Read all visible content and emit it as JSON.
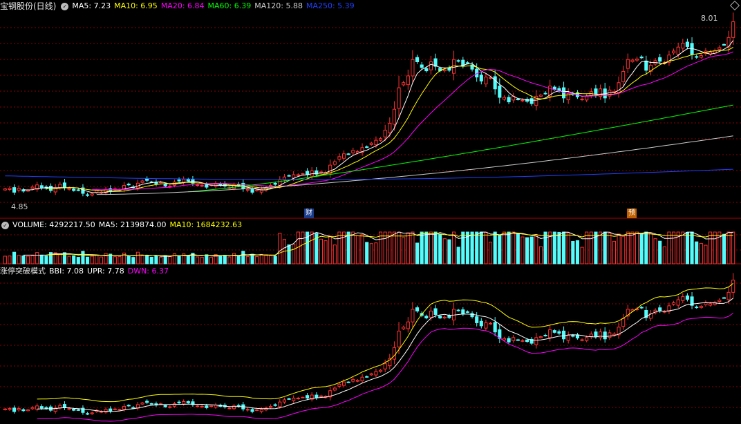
{
  "stock": {
    "name": "宝钢股份(日线)"
  },
  "main_indicators": [
    {
      "label": "MA5: 7.23",
      "color": "#ffffff"
    },
    {
      "label": "MA10: 6.95",
      "color": "#ffff00"
    },
    {
      "label": "MA20: 6.84",
      "color": "#ff00ff"
    },
    {
      "label": "MA60: 6.39",
      "color": "#00ff00"
    },
    {
      "label": "MA120: 5.88",
      "color": "#cccccc"
    },
    {
      "label": "MA250: 5.39",
      "color": "#2040ff"
    }
  ],
  "price_labels": {
    "high": "8.01",
    "low": "4.85"
  },
  "markers": {
    "cai": "财",
    "yu": "预"
  },
  "volume_panel": {
    "indicators": [
      {
        "label": "VOLUME: 4292217.50",
        "color": "#ffffff"
      },
      {
        "label": "MA5: 2139874.00",
        "color": "#ffffff"
      },
      {
        "label": "MA10: 1684232.63",
        "color": "#ffff00"
      }
    ]
  },
  "bbi_panel": {
    "name": "涨停突破模式",
    "indicators": [
      {
        "label": "BBI: 7.08",
        "color": "#ffffff"
      },
      {
        "label": "UPR: 7.78",
        "color": "#ffffff"
      },
      {
        "label": "DWN: 6.37",
        "color": "#ff00ff"
      }
    ]
  },
  "colors": {
    "up": "#ff3232",
    "down": "#54fcfc",
    "grid": "#8b0000",
    "divider": "#b00000"
  },
  "chart_data": {
    "type": "candlestick",
    "closes": [
      5.05,
      5.06,
      4.99,
      5.06,
      5.01,
      5.03,
      5.08,
      5.12,
      5.07,
      5.06,
      5.02,
      5.07,
      5.13,
      5.08,
      5.06,
      5.02,
      5.03,
      4.97,
      4.94,
      4.96,
      5.02,
      4.99,
      5.04,
      5.0,
      5.05,
      5.04,
      5.11,
      5.12,
      5.08,
      5.15,
      5.19,
      5.2,
      5.17,
      5.14,
      5.17,
      5.1,
      5.1,
      5.17,
      5.19,
      5.22,
      5.19,
      5.15,
      5.12,
      5.11,
      5.08,
      5.12,
      5.14,
      5.11,
      5.1,
      5.07,
      5.12,
      5.11,
      5.05,
      5.04,
      4.99,
      5.03,
      5.04,
      5.07,
      5.11,
      5.13,
      5.21,
      5.26,
      5.28,
      5.3,
      5.3,
      5.32,
      5.3,
      5.37,
      5.31,
      5.35,
      5.34,
      5.47,
      5.53,
      5.62,
      5.67,
      5.66,
      5.73,
      5.71,
      5.78,
      5.79,
      5.86,
      5.91,
      5.94,
      6.09,
      6.21,
      6.46,
      6.84,
      6.93,
      7.05,
      7.34,
      7.3,
      7.2,
      7.14,
      7.3,
      7.22,
      7.14,
      7.16,
      7.15,
      7.34,
      7.31,
      7.23,
      7.28,
      7.17,
      7.03,
      6.96,
      7.03,
      7.02,
      6.82,
      6.67,
      6.67,
      6.59,
      6.69,
      6.63,
      6.62,
      6.6,
      6.56,
      6.69,
      6.71,
      6.74,
      6.87,
      6.81,
      6.79,
      6.66,
      6.74,
      6.72,
      6.68,
      6.64,
      6.69,
      6.77,
      6.72,
      6.82,
      6.66,
      6.8,
      6.77,
      6.93,
      7.13,
      7.34,
      7.33,
      7.35,
      7.37,
      7.15,
      7.24,
      7.32,
      7.31,
      7.29,
      7.42,
      7.49,
      7.56,
      7.63,
      7.57,
      7.43,
      7.38,
      7.41,
      7.49,
      7.47,
      7.5,
      7.55,
      7.6,
      7.73,
      8.01
    ],
    "ma_lines": [
      "MA5",
      "MA10",
      "MA20",
      "MA60",
      "MA120",
      "MA250"
    ],
    "volume_unit": "shares",
    "latest": {
      "close": 8.01,
      "low_mark": 4.85
    }
  }
}
